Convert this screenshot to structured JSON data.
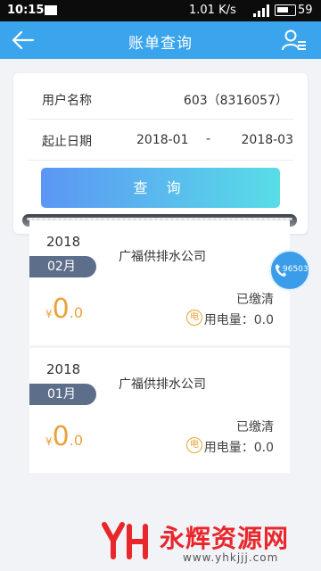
{
  "status_bar": {
    "time": "10:15",
    "speed": "1.01 K/s",
    "battery": "59"
  },
  "title_bar": {
    "title": "账单查询",
    "back_icon": "back-arrow-icon",
    "user_icon": "user-list-icon"
  },
  "query": {
    "user_label": "用户名称",
    "user_value": "603（8316057）",
    "date_label": "起止日期",
    "date_start": "2018-01",
    "date_sep": "-",
    "date_end": "2018-03",
    "button_label": "查 询",
    "button_gradient": [
      "#5b96f4",
      "#58dde7"
    ]
  },
  "bills": [
    {
      "year": "2018",
      "month": "02月",
      "company": "广福供排水公司",
      "status": "已缴清",
      "currency": "¥",
      "amount_int": "0",
      "amount_dec": ".0",
      "elec_icon": "电",
      "usage": "用电量：0.0"
    },
    {
      "year": "2018",
      "month": "01月",
      "company": "广福供排水公司",
      "status": "已缴清",
      "currency": "¥",
      "amount_int": "0",
      "amount_dec": ".0",
      "elec_icon": "电",
      "usage": "用电量：0.0"
    }
  ],
  "float_button": {
    "number": "96503",
    "icon": "phone-icon"
  },
  "watermark": {
    "brand": "永辉资源网",
    "url": "www.yhkjjj.com"
  },
  "colors": {
    "accent": "#3aa4ec",
    "month_tag": "#5d6e8a",
    "amount": "#e8a33a",
    "watermark": "#e8262c"
  }
}
